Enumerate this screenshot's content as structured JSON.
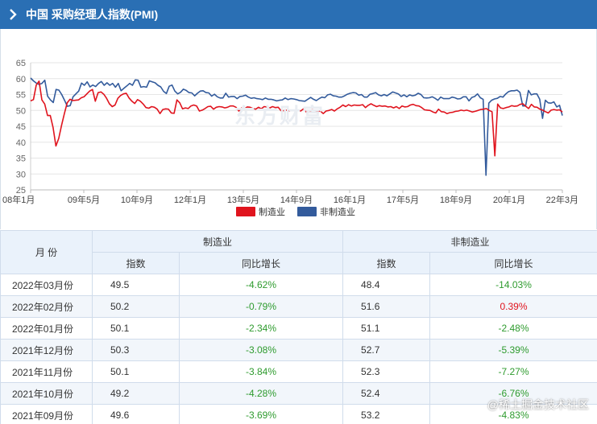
{
  "header": {
    "title": "中国 采购经理人指数(PMI)"
  },
  "watermark": "东方财富",
  "credit": "@稀土掘金技术社区",
  "colors": {
    "header": "#2a6fb4",
    "manufacturing": "#e0141e",
    "non_manufacturing": "#335b9c",
    "negative": "#2e9b2e",
    "positive": "#e0141e"
  },
  "chart_data": {
    "type": "line",
    "x_ticks": [
      "08年1月",
      "09年5月",
      "10年9月",
      "12年1月",
      "13年5月",
      "14年9月",
      "16年1月",
      "17年5月",
      "18年9月",
      "20年1月",
      "22年3月"
    ],
    "y_ticks": [
      25,
      30,
      35,
      40,
      45,
      50,
      55,
      60,
      65
    ],
    "ylim": [
      25,
      65
    ],
    "legend_position": "bottom-center",
    "series": [
      {
        "name": "制造业",
        "values": [
          53,
          53.4,
          58,
          59.2,
          53.3,
          52,
          48.4,
          48.4,
          44.6,
          38.8,
          41.2,
          45.3,
          49,
          52.4,
          53.5,
          53.1,
          53.2,
          53.3,
          54,
          54.3,
          55.2,
          56.1,
          56.6,
          52.9,
          55.6,
          55.8,
          55.1,
          53.8,
          52.1,
          51.2,
          51.7,
          53.8,
          54.7,
          55.2,
          55.4,
          53.9,
          52.9,
          52.2,
          53.4,
          52.9,
          52,
          50.9,
          50.7,
          51.2,
          51,
          50.4,
          49,
          50.3,
          50.5,
          50.4,
          49.2,
          49.1,
          53.3,
          52.4,
          50.5,
          50.8,
          50.6,
          51.4,
          51.7,
          51.4,
          49.8,
          50.1,
          50.6,
          51.2,
          51.3,
          50.4,
          51,
          51.2,
          51.1,
          50.8,
          51,
          51.4,
          51.4,
          51,
          49.8,
          50.8,
          50.5,
          51.1,
          51,
          50.6,
          50.4,
          51,
          50.5,
          51.2,
          51.1,
          50.8,
          51.2,
          50.9,
          51,
          49.9,
          49.9,
          50.1,
          49.8,
          50.1,
          50,
          50.1,
          49.8,
          50.5,
          49.5,
          49.3,
          50.2,
          50.1,
          49.6,
          49.8,
          49,
          49.8,
          50,
          50.3,
          49.8,
          50.5,
          51,
          51.7,
          51.2,
          51.8,
          51.4,
          51.7,
          51.6,
          51.6,
          51.8,
          50.9,
          51.6,
          52.1,
          51.6,
          51.2,
          51.5,
          51.3,
          51.4,
          51.1,
          51.2,
          50.8,
          51.2,
          50.6,
          51.4,
          51.1,
          51.2,
          51.7,
          51.9,
          51.5,
          51.4,
          50.9,
          50.2,
          50.1,
          50,
          49.5,
          49.2,
          50.4,
          49.6,
          49.5,
          49,
          49.3,
          49.4,
          49.7,
          49.8,
          50.1,
          49.9,
          50.1,
          49.8,
          49.5,
          49.7,
          50,
          50.3,
          50.4,
          50.6,
          50,
          49.6,
          35.7,
          52,
          50.8,
          50.6,
          50.9,
          51.1,
          51.5,
          51.3,
          51.4,
          51.9,
          52.1,
          51.3,
          50.6,
          51.9,
          51.1,
          51,
          50.4,
          50.1,
          49.6,
          49.2,
          50.1,
          50.3,
          50.1,
          50.2,
          49.5
        ]
      },
      {
        "name": "非制造业",
        "values": [
          60.2,
          59.3,
          58.6,
          58.2,
          58.5,
          59.5,
          54.5,
          53.3,
          52.5,
          56.6,
          56.4,
          55,
          53.2,
          51.3,
          51.5,
          54.3,
          55.2,
          56.1,
          58.6,
          57.9,
          59,
          57.4,
          58,
          57.5,
          58.5,
          59.1,
          57.9,
          58.7,
          57.9,
          58.5,
          57.3,
          58.5,
          56.2,
          57,
          57.7,
          58.5,
          57.9,
          59.6,
          59.5,
          57.3,
          57.5,
          57.3,
          59.3,
          59,
          58.7,
          57.9,
          57.4,
          56,
          55.3,
          57.6,
          58,
          56.1,
          55.2,
          55.7,
          56.7,
          56.3,
          55.6,
          55.5,
          54.6,
          55.4,
          56.1,
          56.2,
          55.6,
          55.5,
          54.5,
          55.1,
          54.3,
          53.9,
          53.9,
          55.4,
          54.2,
          54.4,
          54.4,
          53.7,
          54.4,
          54.5,
          54.8,
          54.2,
          53.8,
          54,
          53.7,
          53.6,
          53.4,
          53.9,
          53.5,
          53.5,
          53.3,
          53,
          53.2,
          53.3,
          53.9,
          53.4,
          53.7,
          53.6,
          53.4,
          53.1,
          53,
          52.9,
          53.5,
          54.1,
          53.5,
          53.1,
          53.7,
          54.2,
          54,
          54.9,
          55.1,
          54.6,
          54.5,
          54.2,
          54.2,
          54.6,
          55.1,
          55.4,
          55.6,
          55.5,
          54.8,
          55,
          54.2,
          54.2,
          55.1,
          55.3,
          55.6,
          54.9,
          54.6,
          55,
          54.6,
          55.2,
          55.8,
          55.5,
          55.2,
          54.4,
          54.9,
          54.3,
          54.9,
          54.6,
          54.8,
          55.4,
          55,
          54,
          53.9,
          54,
          54.3,
          53.8,
          53.2,
          54.2,
          53.7,
          53.7,
          53.7,
          54.2,
          54,
          53.6,
          53.7,
          54.3,
          54.3,
          53,
          54.1,
          54.4,
          55.2,
          54,
          53.5,
          29.6,
          52.3,
          53.2,
          53.6,
          53.8,
          54.4,
          54.2,
          55.2,
          55.9,
          56.2,
          56.2,
          56.4,
          55.7,
          51.4,
          51.4,
          56.3,
          54.9,
          55.2,
          55.2,
          53.5,
          47.5,
          53.2,
          52.4,
          52.3,
          52.7,
          51.1,
          51.6,
          48.4
        ]
      }
    ]
  },
  "table": {
    "col_month": "月  份",
    "group_mfg": "制造业",
    "group_nonmfg": "非制造业",
    "sub_index": "指数",
    "sub_yoy": "同比增长",
    "rows": [
      {
        "month": "2022年03月份",
        "m_idx": "49.5",
        "m_yoy": "-4.62%",
        "n_idx": "48.4",
        "n_yoy": "-14.03%"
      },
      {
        "month": "2022年02月份",
        "m_idx": "50.2",
        "m_yoy": "-0.79%",
        "n_idx": "51.6",
        "n_yoy": "0.39%"
      },
      {
        "month": "2022年01月份",
        "m_idx": "50.1",
        "m_yoy": "-2.34%",
        "n_idx": "51.1",
        "n_yoy": "-2.48%"
      },
      {
        "month": "2021年12月份",
        "m_idx": "50.3",
        "m_yoy": "-3.08%",
        "n_idx": "52.7",
        "n_yoy": "-5.39%"
      },
      {
        "month": "2021年11月份",
        "m_idx": "50.1",
        "m_yoy": "-3.84%",
        "n_idx": "52.3",
        "n_yoy": "-7.27%"
      },
      {
        "month": "2021年10月份",
        "m_idx": "49.2",
        "m_yoy": "-4.28%",
        "n_idx": "52.4",
        "n_yoy": "-6.76%"
      },
      {
        "month": "2021年09月份",
        "m_idx": "49.6",
        "m_yoy": "-3.69%",
        "n_idx": "53.2",
        "n_yoy": "-4.83%"
      }
    ]
  }
}
